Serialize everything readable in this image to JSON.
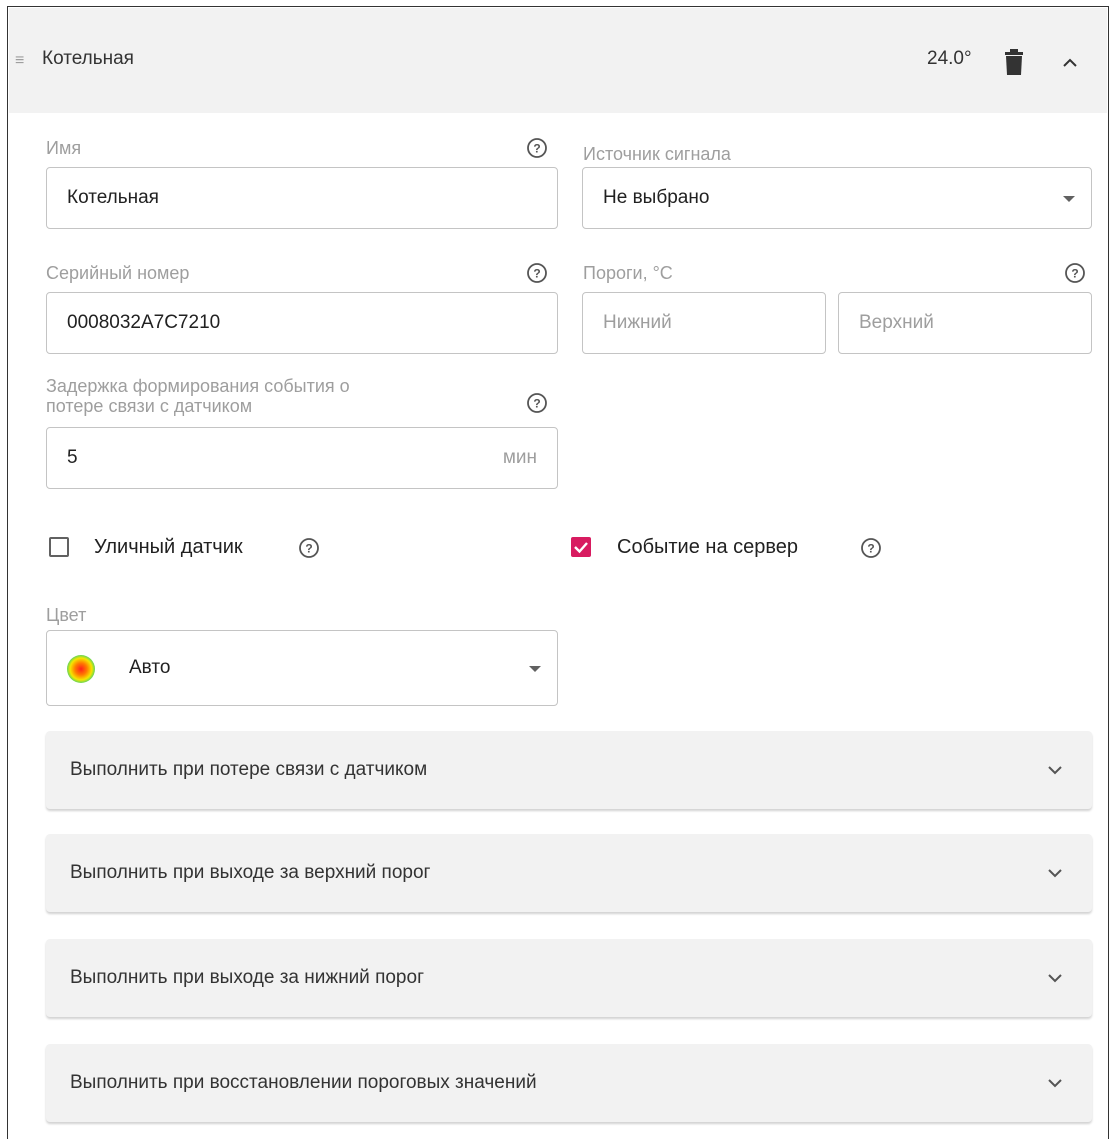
{
  "header": {
    "title": "Котельная",
    "temperature": "24.0°",
    "drag_handle": "≡"
  },
  "form": {
    "name": {
      "label": "Имя",
      "value": "Котельная"
    },
    "signal_source": {
      "label": "Источник сигнала",
      "value": "Не выбрано"
    },
    "serial": {
      "label": "Серийный номер",
      "value": "0008032A7C7210"
    },
    "thresholds": {
      "label": "Пороги, °C",
      "lower_placeholder": "Нижний",
      "upper_placeholder": "Верхний"
    },
    "delay": {
      "label_line1": "Задержка формирования события о",
      "label_line2": "потере связи с датчиком",
      "value": "5",
      "unit": "мин"
    },
    "outdoor_sensor": {
      "label": "Уличный датчик",
      "checked": false
    },
    "server_event": {
      "label": "Событие на сервер",
      "checked": true
    },
    "color": {
      "label": "Цвет",
      "value": "Авто"
    }
  },
  "panels": [
    {
      "title": "Выполнить при потере связи с датчиком"
    },
    {
      "title": "Выполнить при выходе за верхний порог"
    },
    {
      "title": "Выполнить при выходе за нижний порог"
    },
    {
      "title": "Выполнить при восстановлении пороговых значений"
    }
  ],
  "icons": {
    "help": "help-circle-icon",
    "delete": "trash-icon",
    "collapse": "chevron-up-icon",
    "expand": "chevron-down-icon",
    "dropdown": "caret-down-icon",
    "check": "check-icon"
  },
  "colors": {
    "accent": "#d81b60",
    "header_bg": "#f2f2f2",
    "label": "#9e9e9e",
    "border": "#c4c4c4"
  }
}
